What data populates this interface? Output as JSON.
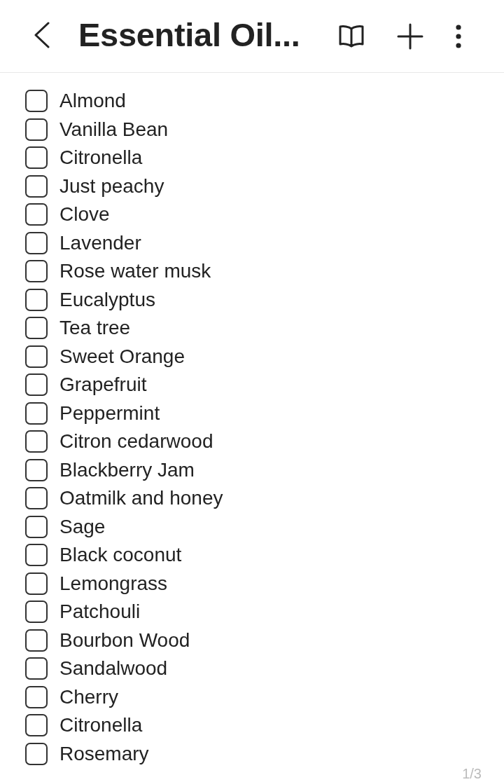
{
  "header": {
    "title": "Essential Oil..."
  },
  "checklist": [
    {
      "label": "Almond",
      "checked": false
    },
    {
      "label": "Vanilla Bean",
      "checked": false
    },
    {
      "label": "Citronella",
      "checked": false
    },
    {
      "label": "Just peachy",
      "checked": false
    },
    {
      "label": "Clove",
      "checked": false
    },
    {
      "label": "Lavender",
      "checked": false
    },
    {
      "label": "Rose water musk",
      "checked": false
    },
    {
      "label": "Eucalyptus",
      "checked": false
    },
    {
      "label": "Tea tree",
      "checked": false
    },
    {
      "label": "Sweet Orange",
      "checked": false
    },
    {
      "label": "Grapefruit",
      "checked": false
    },
    {
      "label": "Peppermint",
      "checked": false
    },
    {
      "label": "Citron cedarwood",
      "checked": false
    },
    {
      "label": "Blackberry Jam",
      "checked": false
    },
    {
      "label": "Oatmilk and honey",
      "checked": false
    },
    {
      "label": "Sage",
      "checked": false
    },
    {
      "label": "Black coconut",
      "checked": false
    },
    {
      "label": "Lemongrass",
      "checked": false
    },
    {
      "label": "Patchouli",
      "checked": false
    },
    {
      "label": "Bourbon Wood",
      "checked": false
    },
    {
      "label": "Sandalwood",
      "checked": false
    },
    {
      "label": "Cherry",
      "checked": false
    },
    {
      "label": "Citronella",
      "checked": false
    },
    {
      "label": "Rosemary",
      "checked": false
    }
  ],
  "page_indicator": "1/3"
}
